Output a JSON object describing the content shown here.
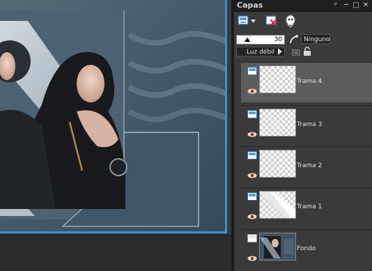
{
  "panel": {
    "title": "Capas",
    "pin_glyph": "ᵖ",
    "min_glyph": "─",
    "max_glyph": "□",
    "close_glyph": "✕"
  },
  "controls": {
    "opacity_value": "30",
    "opacity_fraction": 0.3,
    "blend_mode": "Ninguno",
    "mask_mode": "Luz débil"
  },
  "layers": [
    {
      "name": "Trama 4",
      "selected": true
    },
    {
      "name": "Trama 3",
      "selected": false
    },
    {
      "name": "Trama 2",
      "selected": false
    },
    {
      "name": "Trama 1",
      "selected": false
    },
    {
      "name": "Fondo",
      "selected": false
    }
  ],
  "colors": {
    "accent": "#3a8fd1",
    "panel_bg": "#3a3a3a",
    "selected_row": "#5c5c5c"
  }
}
